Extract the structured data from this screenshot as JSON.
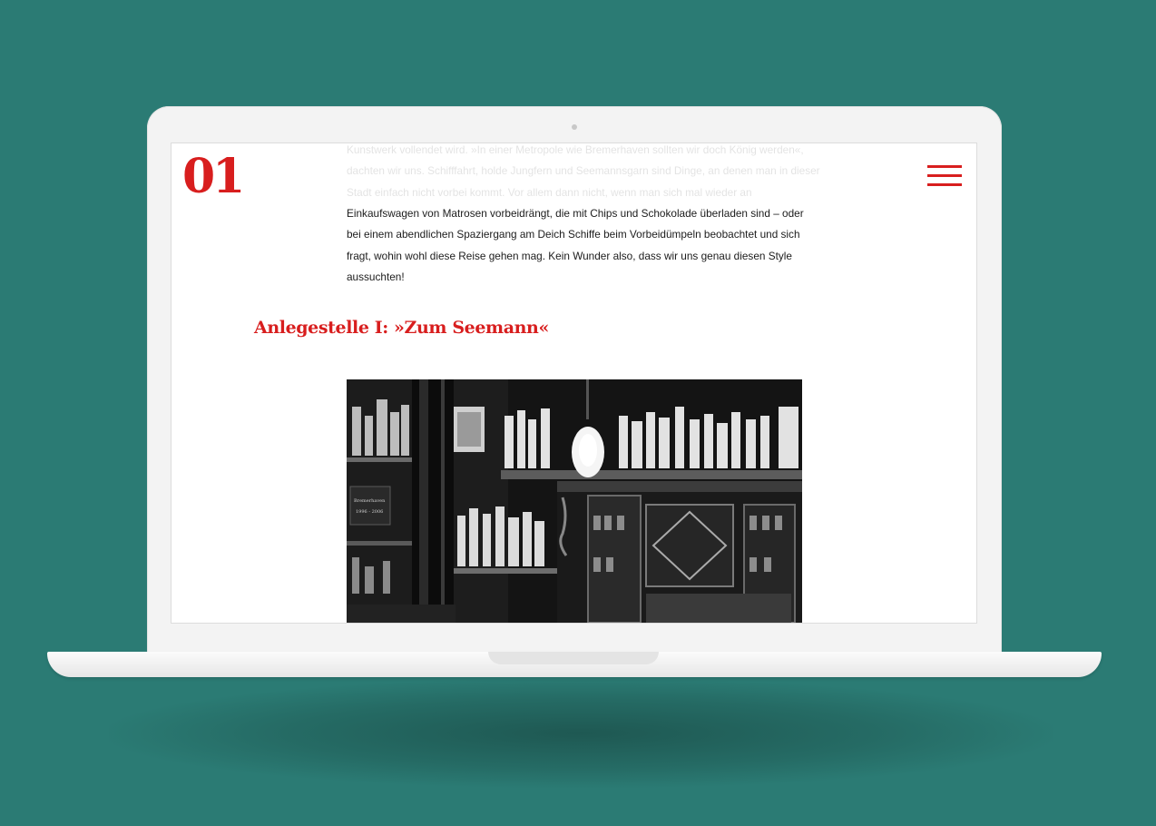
{
  "site": {
    "logo_text": "01",
    "menu_icon": "hamburger-menu-icon",
    "accent_color": "#d81e1e",
    "background_color": "#2b7b74"
  },
  "article": {
    "faded_lines": [
      "Kunstwerk vollendet wird. »In einer Metropole wie Bremerhaven sollten wir doch König werden«,",
      "dachten wir uns. Schifffahrt, holde Jungfern und Seemannsgarn sind Dinge, an denen man in dieser",
      "Stadt einfach nicht vorbei kommt. Vor allem dann nicht, wenn man sich mal wieder an"
    ],
    "body_lines": [
      "Einkaufswagen von Matrosen vorbeidrängt, die mit Chips und Schokolade überladen sind – oder",
      "bei einem abendlichen Spaziergang am Deich Schiffe beim Vorbeidümpeln beobachtet und sich",
      "fragt, wohin wohl diese Reise gehen mag. Kein Wunder also, dass wir uns genau diesen Style",
      "aussuchten!"
    ],
    "section_heading": "Anlegestelle I: »Zum Seemann«",
    "photo": {
      "subject": "black-and-white bar interior with bottles and cabinets",
      "sign_lines": [
        "Bremerhaven",
        "1996 - 2006"
      ]
    }
  }
}
